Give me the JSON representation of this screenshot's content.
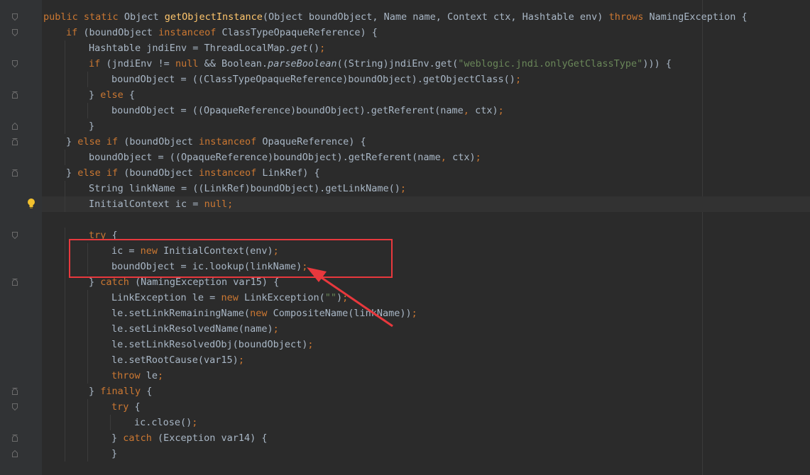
{
  "editor": {
    "lines": [
      {
        "indent": 0,
        "fold": "open",
        "tokens": [
          [
            "kw",
            "public "
          ],
          [
            "kw",
            "static "
          ],
          [
            "plain",
            "Object "
          ],
          [
            "fn",
            "getObjectInstance"
          ],
          [
            "plain",
            "(Object boundObject, Name name, Context ctx, Hashtable env) "
          ],
          [
            "kw",
            "throws "
          ],
          [
            "plain",
            "NamingException {"
          ]
        ]
      },
      {
        "indent": 1,
        "fold": "open",
        "tokens": [
          [
            "kw",
            "if "
          ],
          [
            "plain",
            "(boundObject "
          ],
          [
            "kw",
            "instanceof "
          ],
          [
            "plain",
            "ClassTypeOpaqueReference) {"
          ]
        ]
      },
      {
        "indent": 2,
        "fold": "",
        "tokens": [
          [
            "plain",
            "Hashtable jndiEnv = ThreadLocalMap."
          ],
          [
            "it",
            "get"
          ],
          [
            "plain",
            "()"
          ],
          [
            "kw",
            ";"
          ]
        ]
      },
      {
        "indent": 2,
        "fold": "open",
        "tokens": [
          [
            "kw",
            "if "
          ],
          [
            "plain",
            "(jndiEnv != "
          ],
          [
            "kw",
            "null "
          ],
          [
            "plain",
            "&& Boolean."
          ],
          [
            "it",
            "parseBoolean"
          ],
          [
            "plain",
            "((String)jndiEnv.get("
          ],
          [
            "str",
            "\"weblogic.jndi.onlyGetClassType\""
          ],
          [
            "plain",
            "))) {"
          ]
        ]
      },
      {
        "indent": 3,
        "fold": "",
        "tokens": [
          [
            "plain",
            "boundObject = ((ClassTypeOpaqueReference)boundObject).getObjectClass()"
          ],
          [
            "kw",
            ";"
          ]
        ]
      },
      {
        "indent": 2,
        "fold": "mid",
        "tokens": [
          [
            "plain",
            "} "
          ],
          [
            "kw",
            "else "
          ],
          [
            "plain",
            "{"
          ]
        ]
      },
      {
        "indent": 3,
        "fold": "",
        "tokens": [
          [
            "plain",
            "boundObject = ((OpaqueReference)boundObject).getReferent(name"
          ],
          [
            "kw",
            ", "
          ],
          [
            "plain",
            "ctx)"
          ],
          [
            "kw",
            ";"
          ]
        ]
      },
      {
        "indent": 2,
        "fold": "close",
        "tokens": [
          [
            "plain",
            "}"
          ]
        ]
      },
      {
        "indent": 1,
        "fold": "mid",
        "tokens": [
          [
            "plain",
            "} "
          ],
          [
            "kw",
            "else if "
          ],
          [
            "plain",
            "(boundObject "
          ],
          [
            "kw",
            "instanceof "
          ],
          [
            "plain",
            "OpaqueReference) {"
          ]
        ]
      },
      {
        "indent": 2,
        "fold": "",
        "tokens": [
          [
            "plain",
            "boundObject = ((OpaqueReference)boundObject).getReferent(name"
          ],
          [
            "kw",
            ", "
          ],
          [
            "plain",
            "ctx)"
          ],
          [
            "kw",
            ";"
          ]
        ]
      },
      {
        "indent": 1,
        "fold": "mid",
        "tokens": [
          [
            "plain",
            "} "
          ],
          [
            "kw",
            "else if "
          ],
          [
            "plain",
            "(boundObject "
          ],
          [
            "kw",
            "instanceof "
          ],
          [
            "plain",
            "LinkRef) {"
          ]
        ]
      },
      {
        "indent": 2,
        "fold": "",
        "tokens": [
          [
            "plain",
            "String linkName = ((LinkRef)boundObject).getLinkName()"
          ],
          [
            "kw",
            ";"
          ]
        ]
      },
      {
        "indent": 2,
        "fold": "",
        "highlight": true,
        "bulb": true,
        "tokens": [
          [
            "plain",
            "InitialContext ic = "
          ],
          [
            "kw",
            "null;"
          ]
        ]
      },
      {
        "indent": 0,
        "fold": "",
        "tokens": []
      },
      {
        "indent": 2,
        "fold": "open",
        "tokens": [
          [
            "kw",
            "try "
          ],
          [
            "plain",
            "{"
          ]
        ]
      },
      {
        "indent": 3,
        "fold": "",
        "tokens": [
          [
            "plain",
            "ic = "
          ],
          [
            "kw",
            "new "
          ],
          [
            "plain",
            "InitialContext(env)"
          ],
          [
            "kw",
            ";"
          ]
        ]
      },
      {
        "indent": 3,
        "fold": "",
        "tokens": [
          [
            "plain",
            "boundObject = ic.lookup(linkName)"
          ],
          [
            "kw",
            ";"
          ]
        ]
      },
      {
        "indent": 2,
        "fold": "mid",
        "tokens": [
          [
            "plain",
            "} "
          ],
          [
            "kw",
            "catch "
          ],
          [
            "plain",
            "(NamingException var15) {"
          ]
        ]
      },
      {
        "indent": 3,
        "fold": "",
        "tokens": [
          [
            "plain",
            "LinkException le = "
          ],
          [
            "kw",
            "new "
          ],
          [
            "plain",
            "LinkException("
          ],
          [
            "str",
            "\"\""
          ],
          [
            "plain",
            ")"
          ],
          [
            "kw",
            ";"
          ]
        ]
      },
      {
        "indent": 3,
        "fold": "",
        "tokens": [
          [
            "plain",
            "le.setLinkRemainingName("
          ],
          [
            "kw",
            "new "
          ],
          [
            "plain",
            "CompositeName(linkName))"
          ],
          [
            "kw",
            ";"
          ]
        ]
      },
      {
        "indent": 3,
        "fold": "",
        "tokens": [
          [
            "plain",
            "le.setLinkResolvedName(name)"
          ],
          [
            "kw",
            ";"
          ]
        ]
      },
      {
        "indent": 3,
        "fold": "",
        "tokens": [
          [
            "plain",
            "le.setLinkResolvedObj(boundObject)"
          ],
          [
            "kw",
            ";"
          ]
        ]
      },
      {
        "indent": 3,
        "fold": "",
        "tokens": [
          [
            "plain",
            "le.setRootCause(var15)"
          ],
          [
            "kw",
            ";"
          ]
        ]
      },
      {
        "indent": 3,
        "fold": "",
        "tokens": [
          [
            "kw",
            "throw "
          ],
          [
            "plain",
            "le"
          ],
          [
            "kw",
            ";"
          ]
        ]
      },
      {
        "indent": 2,
        "fold": "mid",
        "tokens": [
          [
            "plain",
            "} "
          ],
          [
            "kw",
            "finally "
          ],
          [
            "plain",
            "{"
          ]
        ]
      },
      {
        "indent": 3,
        "fold": "open",
        "tokens": [
          [
            "kw",
            "try "
          ],
          [
            "plain",
            "{"
          ]
        ]
      },
      {
        "indent": 4,
        "fold": "",
        "tokens": [
          [
            "plain",
            "ic.close()"
          ],
          [
            "kw",
            ";"
          ]
        ]
      },
      {
        "indent": 3,
        "fold": "mid",
        "tokens": [
          [
            "plain",
            "} "
          ],
          [
            "kw",
            "catch "
          ],
          [
            "plain",
            "(Exception var14) {"
          ]
        ]
      },
      {
        "indent": 3,
        "fold": "close",
        "tokens": [
          [
            "plain",
            "}"
          ]
        ]
      }
    ]
  },
  "colors": {
    "background": "#2b2b2b",
    "gutter": "#313335",
    "keyword": "#cc7832",
    "method_decl": "#ffc66d",
    "string": "#6a8759",
    "text": "#a9b7c6",
    "annotation_red": "#e8383d",
    "bulb": "#f2c12e"
  },
  "icons": {
    "fold_marker": "fold-marker-icon",
    "intention_bulb": "lightbulb-icon"
  }
}
